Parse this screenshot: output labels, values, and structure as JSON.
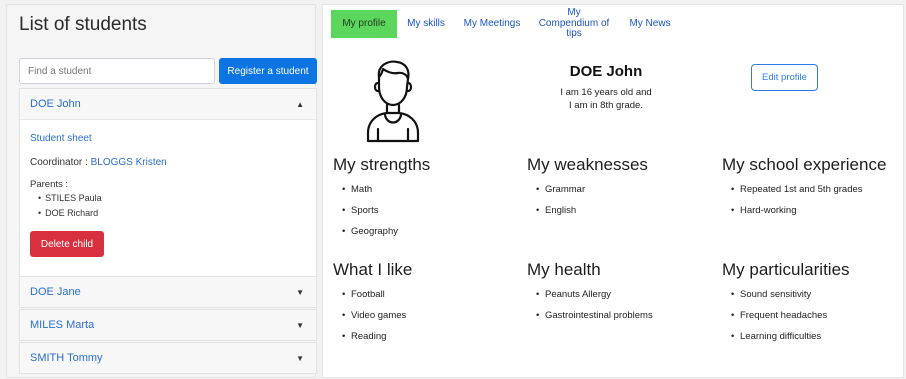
{
  "sidebar": {
    "title": "List of students",
    "search_placeholder": "Find a student",
    "register_label": "Register a student",
    "students": [
      {
        "name": "DOE John",
        "expanded": true,
        "sheet_link": "Student sheet",
        "coordinator_label": "Coordinator : ",
        "coordinator_name": "BLOGGS Kristen",
        "parents_label": "Parents :",
        "parents": [
          "STILES Paula",
          "DOE Richard"
        ],
        "delete_label": "Delete child"
      },
      {
        "name": "DOE Jane",
        "expanded": false
      },
      {
        "name": "MILES Marta",
        "expanded": false
      },
      {
        "name": "SMITH Tommy",
        "expanded": false
      }
    ]
  },
  "tabs": [
    {
      "label": "My profile",
      "active": true
    },
    {
      "label": "My skills",
      "active": false
    },
    {
      "label": "My Meetings",
      "active": false
    },
    {
      "label": "My Compendium of tips",
      "active": false
    },
    {
      "label": "My News",
      "active": false
    }
  ],
  "profile": {
    "name": "DOE John",
    "bio_line1": "I am 16 years old and",
    "bio_line2": "I am in 8th grade.",
    "edit_label": "Edit profile",
    "avatar_icon": "student-avatar-icon"
  },
  "sections": [
    {
      "title": "My strengths",
      "items": [
        "Math",
        "Sports",
        "Geography"
      ]
    },
    {
      "title": "My weaknesses",
      "items": [
        "Grammar",
        "English"
      ]
    },
    {
      "title": "My school experience",
      "items": [
        "Repeated 1st and 5th grades",
        "Hard-working"
      ]
    },
    {
      "title": "What I like",
      "items": [
        "Football",
        "Video games",
        "Reading"
      ]
    },
    {
      "title": "My health",
      "items": [
        "Peanuts Allergy",
        "Gastrointestinal problems"
      ]
    },
    {
      "title": "My particularities",
      "items": [
        "Sound sensitivity",
        "Frequent headaches",
        "Learning difficulties"
      ]
    }
  ],
  "colors": {
    "primary": "#0d74e3",
    "danger": "#d93040",
    "active_tab": "#5cd65c",
    "link": "#2a6fd1"
  }
}
